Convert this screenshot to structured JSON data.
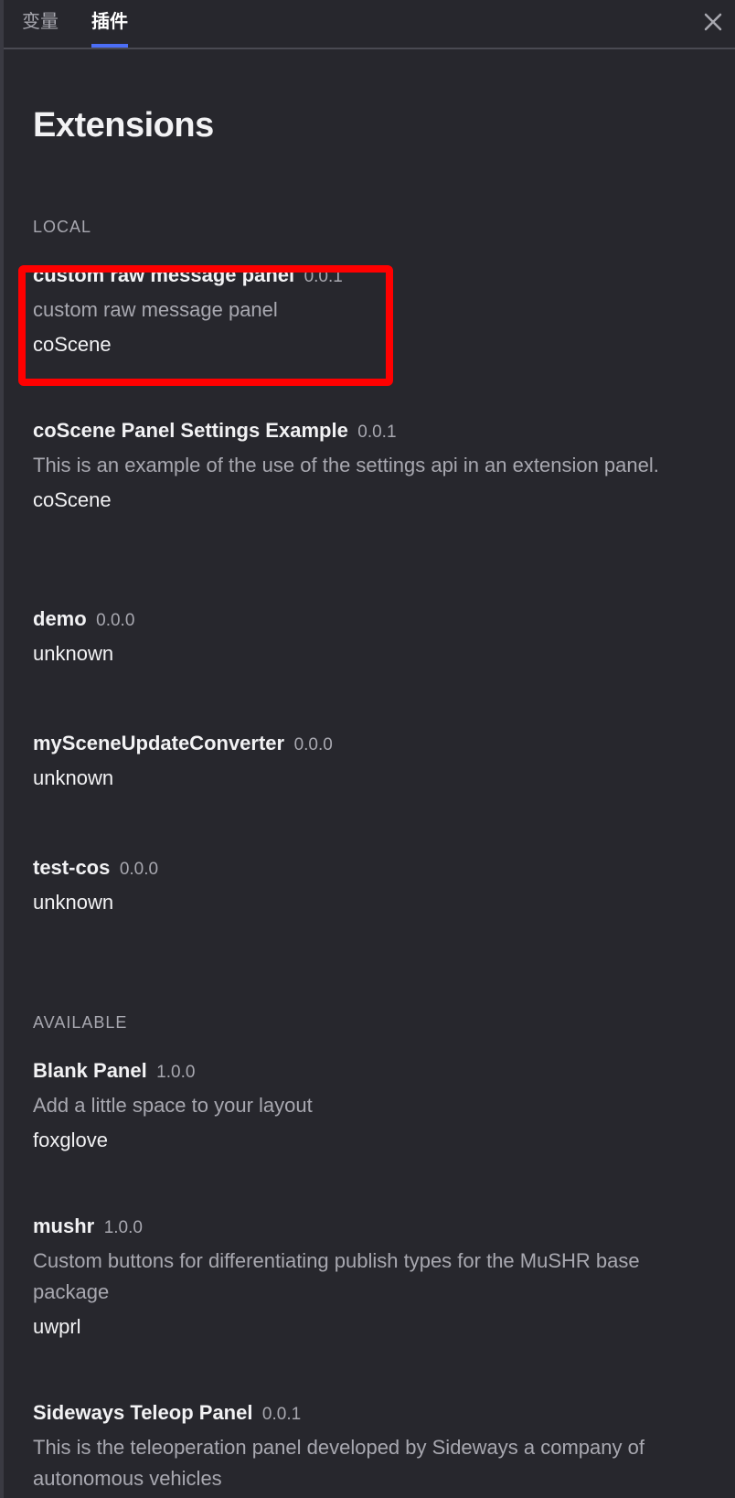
{
  "tabs": [
    {
      "label": "变量",
      "active": false
    },
    {
      "label": "插件",
      "active": true
    }
  ],
  "title": "Extensions",
  "sections": {
    "local": {
      "label": "LOCAL",
      "items": [
        {
          "name": "custom raw message panel",
          "version": "0.0.1",
          "description": "custom raw message panel",
          "publisher": "coScene"
        },
        {
          "name": "coScene Panel Settings Example",
          "version": "0.0.1",
          "description": "This is an example of the use of the settings api in an extension panel.",
          "publisher": "coScene"
        },
        {
          "name": "demo",
          "version": "0.0.0",
          "publisher": "unknown"
        },
        {
          "name": "mySceneUpdateConverter",
          "version": "0.0.0",
          "publisher": "unknown"
        },
        {
          "name": "test-cos",
          "version": "0.0.0",
          "publisher": "unknown"
        }
      ]
    },
    "available": {
      "label": "AVAILABLE",
      "items": [
        {
          "name": "Blank Panel",
          "version": "1.0.0",
          "description": "Add a little space to your layout",
          "publisher": "foxglove"
        },
        {
          "name": "mushr",
          "version": "1.0.0",
          "description": "Custom buttons for differentiating publish types for the MuSHR base package",
          "publisher": "uwprl"
        },
        {
          "name": "Sideways Teleop Panel",
          "version": "0.0.1",
          "description": "This is the teleoperation panel developed by Sideways a company of autonomous vehicles"
        }
      ]
    }
  },
  "colors": {
    "background": "#27272d",
    "text_primary": "#f2f2f4",
    "text_secondary": "#a8a8b0",
    "accent": "#4c6ef5",
    "highlight": "#ff0000"
  },
  "icons": {
    "close": "close-icon"
  }
}
